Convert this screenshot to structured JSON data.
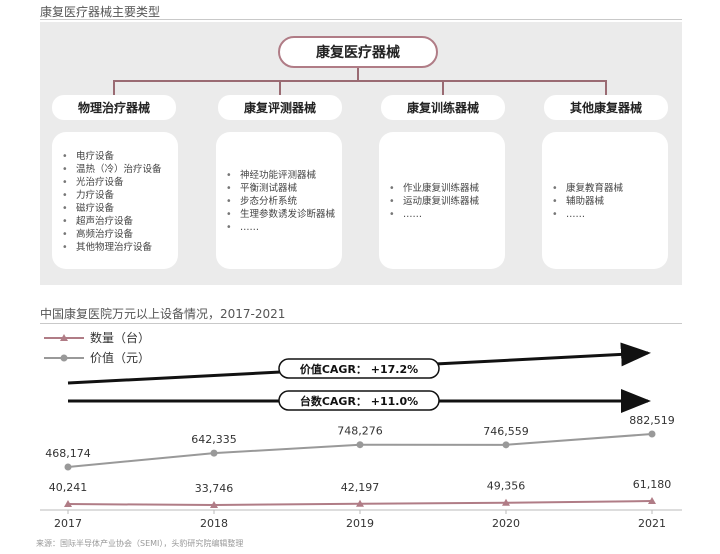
{
  "section1_title": "康复医疗器械主要类型",
  "root_label": "康复医疗器械",
  "categories": [
    {
      "title": "物理治疗器械",
      "items": [
        "电疗设备",
        "温热（冷）治疗设备",
        "光治疗设备",
        "力疗设备",
        "磁疗设备",
        "超声治疗设备",
        "高频治疗设备",
        "其他物理治疗设备"
      ]
    },
    {
      "title": "康复评测器械",
      "items": [
        "神经功能评测器械",
        "平衡测试器械",
        "步态分析系统",
        "生理参数诱发诊断器械",
        "……"
      ]
    },
    {
      "title": "康复训练器械",
      "items": [
        "作业康复训练器械",
        "运动康复训练器械",
        "……"
      ]
    },
    {
      "title": "其他康复器械",
      "items": [
        "康复教育器械",
        "辅助器械",
        "……"
      ]
    }
  ],
  "section2_title": "中国康复医院万元以上设备情况，2017-2021",
  "legend": {
    "quantity": "数量（台）",
    "value": "价值（元）"
  },
  "cagr": {
    "value_label": "价值CAGR：  +17.2%",
    "count_label": "台数CAGR：  +11.0%"
  },
  "source": "来源：国际半导体产业协会（SEMI），头豹研究院编辑整理",
  "colors": {
    "quantity": "#b07c86",
    "value": "#999999",
    "accent": "#b07c86"
  },
  "chart_data": {
    "type": "line",
    "categories": [
      "2017",
      "2018",
      "2019",
      "2020",
      "2021"
    ],
    "series": [
      {
        "name": "价值（元）",
        "values": [
          468174,
          642335,
          748276,
          746559,
          882519
        ],
        "labels": [
          "468,174",
          "642,335",
          "748,276",
          "746,559",
          "882,519"
        ]
      },
      {
        "name": "数量（台）",
        "values": [
          40241,
          33746,
          42197,
          49356,
          61180
        ],
        "labels": [
          "40,241",
          "33,746",
          "42,197",
          "49,356",
          "61,180"
        ]
      }
    ]
  }
}
